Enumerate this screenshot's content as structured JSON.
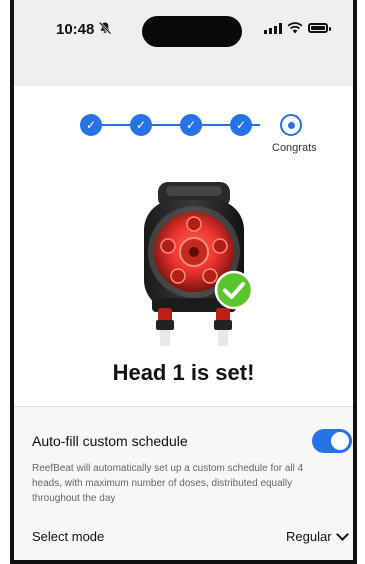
{
  "status_bar": {
    "time": "10:48",
    "mute_icon": "bell-slash-icon"
  },
  "stepper": {
    "steps": [
      {
        "state": "done"
      },
      {
        "state": "done"
      },
      {
        "state": "done"
      },
      {
        "state": "done"
      },
      {
        "state": "current"
      }
    ],
    "current_label": "Congrats",
    "check_glyph": "✓",
    "accent_color": "#2573e6"
  },
  "hero": {
    "headline": "Head 1 is set!",
    "badge_icon": "check-icon"
  },
  "autofill": {
    "title": "Auto-fill custom schedule",
    "enabled": true,
    "description": "ReefBeat will automatically set up a custom schedule for all 4 heads, with maximum number of doses, distributed equally throughout the day"
  },
  "mode": {
    "label": "Select mode",
    "value": "Regular"
  }
}
